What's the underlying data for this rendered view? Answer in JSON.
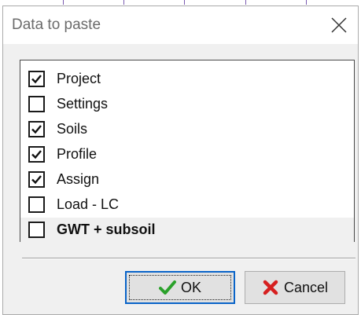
{
  "window": {
    "title": "Data to paste"
  },
  "items": [
    {
      "label": "Project",
      "checked": true,
      "bold": false
    },
    {
      "label": "Settings",
      "checked": false,
      "bold": false
    },
    {
      "label": "Soils",
      "checked": true,
      "bold": false
    },
    {
      "label": "Profile",
      "checked": true,
      "bold": false
    },
    {
      "label": "Assign",
      "checked": true,
      "bold": false
    },
    {
      "label": "Load - LC",
      "checked": false,
      "bold": false
    },
    {
      "label": "GWT + subsoil",
      "checked": false,
      "bold": true
    }
  ],
  "buttons": {
    "ok_label": "OK",
    "cancel_label": "Cancel"
  },
  "icons": {
    "ok": "check-icon",
    "cancel": "x-icon",
    "close": "close-icon"
  },
  "colors": {
    "ok_icon": "#2aa12a",
    "cancel_icon": "#d62020",
    "focus_border": "#0a64c8"
  }
}
